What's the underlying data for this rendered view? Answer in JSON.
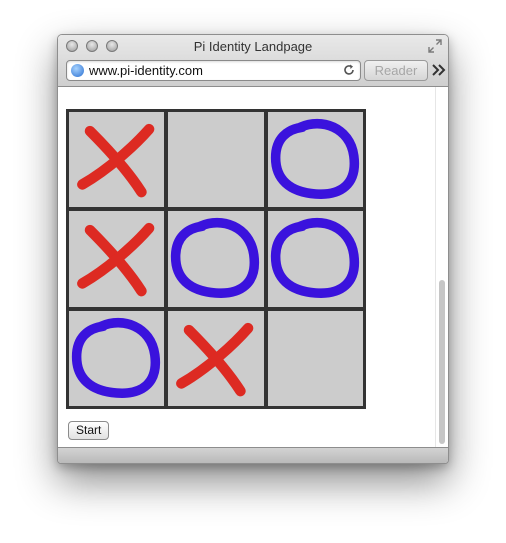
{
  "window": {
    "title": "Pi Identity Landpage"
  },
  "toolbar": {
    "url": "www.pi-identity.com",
    "reader_label": "Reader",
    "icons": {
      "site": "globe-icon",
      "reload": "reload-icon",
      "overflow": "double-chevron-right-icon",
      "fullscreen": "fullscreen-icon"
    }
  },
  "board": {
    "cells": [
      "X",
      "",
      "O",
      "X",
      "O",
      "O",
      "O",
      "X",
      ""
    ],
    "x_color": "#dd2a22",
    "o_color": "#3a12dd",
    "cell_color": "#cccccc",
    "grid_color": "#333333"
  },
  "controls": {
    "start_label": "Start"
  }
}
